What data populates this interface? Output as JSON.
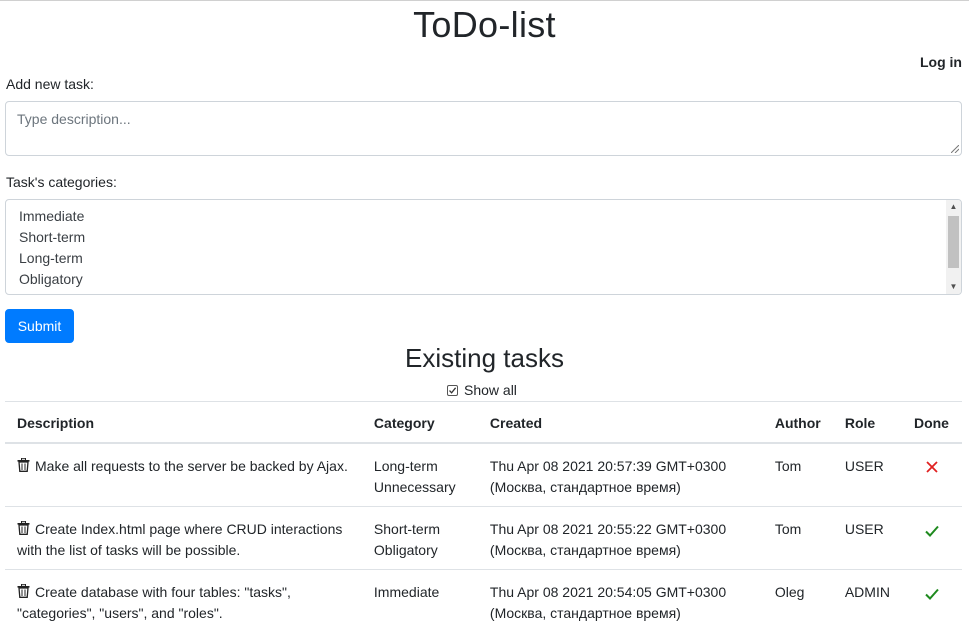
{
  "page": {
    "title": "ToDo-list",
    "login": "Log in"
  },
  "form": {
    "description_label": "Add new task:",
    "description_placeholder": "Type description...",
    "categories_label": "Task's categories:",
    "categories": [
      "Immediate",
      "Short-term",
      "Long-term",
      "Obligatory"
    ],
    "submit_label": "Submit"
  },
  "tasks_section": {
    "title": "Existing tasks",
    "show_all_label": "Show all",
    "show_all_checked": true
  },
  "table": {
    "headers": [
      "Description",
      "Category",
      "Created",
      "Author",
      "Role",
      "Done"
    ],
    "rows": [
      {
        "description": "Make all requests to the server be backed by Ajax.",
        "categories": [
          "Long-term",
          "Unnecessary"
        ],
        "created": [
          "Thu Apr 08 2021 20:57:39 GMT+0300",
          "(Москва, стандартное время)"
        ],
        "author": "Tom",
        "role": "USER",
        "done": false
      },
      {
        "description": "Create Index.html page where CRUD interactions with the list of tasks will be possible.",
        "categories": [
          "Short-term",
          "Obligatory"
        ],
        "created": [
          "Thu Apr 08 2021 20:55:22 GMT+0300",
          "(Москва, стандартное время)"
        ],
        "author": "Tom",
        "role": "USER",
        "done": true
      },
      {
        "description": "Create database with four tables: \"tasks\", \"categories\", \"users\", and \"roles\".",
        "categories": [
          "Immediate"
        ],
        "created": [
          "Thu Apr 08 2021 20:54:05 GMT+0300",
          "(Москва, стандартное время)"
        ],
        "author": "Oleg",
        "role": "ADMIN",
        "done": true
      }
    ]
  },
  "colors": {
    "primary": "#007bff",
    "done_check": "#1e8a1e",
    "not_done": "#e02020"
  }
}
